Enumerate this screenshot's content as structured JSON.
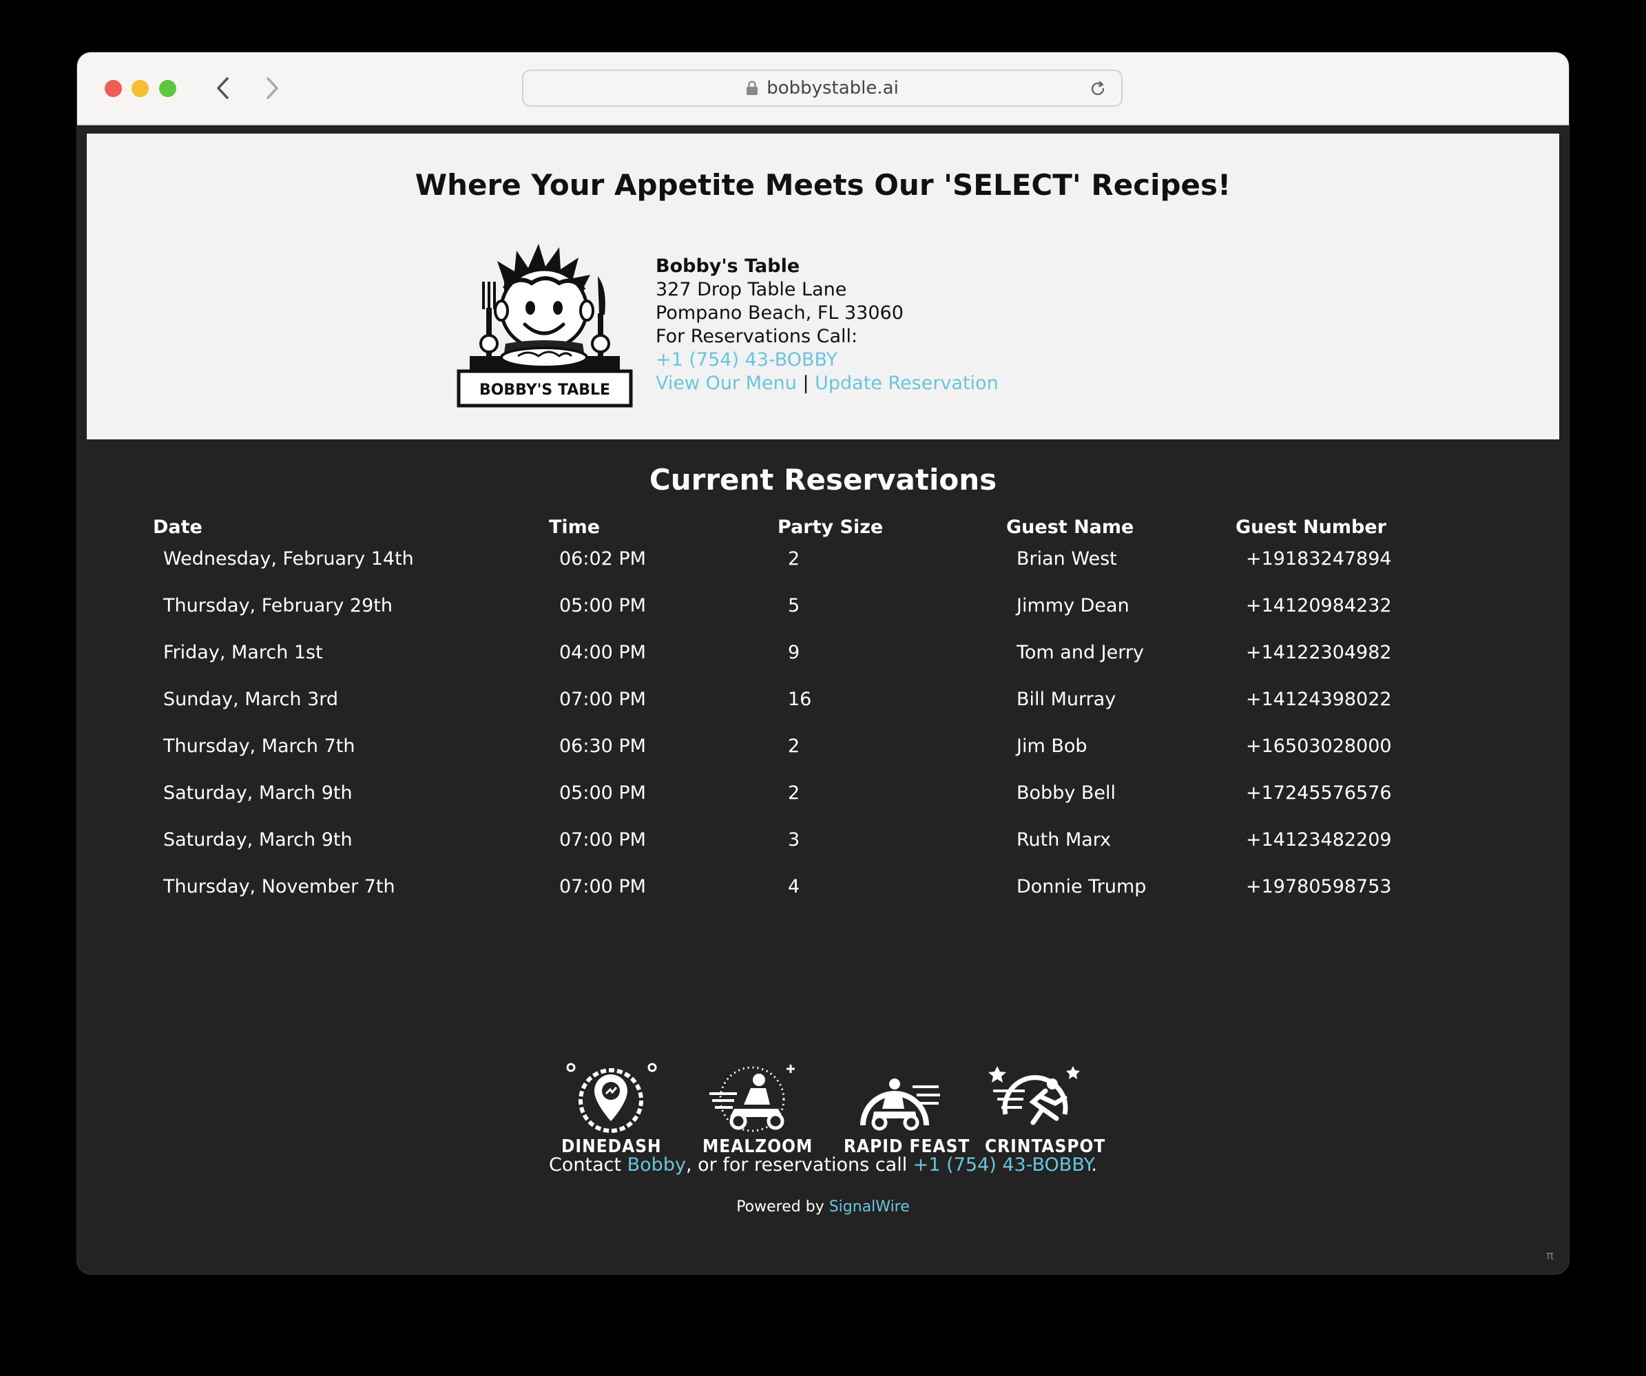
{
  "browser": {
    "url": "bobbystable.ai"
  },
  "header": {
    "headline": "Where Your Appetite Meets Our 'SELECT' Recipes!",
    "logo_text": "BOBBY'S TABLE",
    "restaurant_name": "Bobby's Table",
    "address_line1": "327 Drop Table Lane",
    "address_line2": "Pompano Beach, FL 33060",
    "reservations_label": "For Reservations Call:",
    "phone": "+1 (754) 43-BOBBY",
    "menu_link": "View Our Menu",
    "separator": "|",
    "update_link": "Update Reservation"
  },
  "reservations": {
    "title": "Current Reservations",
    "columns": [
      "Date",
      "Time",
      "Party Size",
      "Guest Name",
      "Guest Number"
    ],
    "rows": [
      [
        "Wednesday, February 14th",
        "06:02 PM",
        "2",
        "Brian West",
        "+19183247894"
      ],
      [
        "Thursday, February 29th",
        "05:00 PM",
        "5",
        "Jimmy Dean",
        "+14120984232"
      ],
      [
        "Friday, March 1st",
        "04:00 PM",
        "9",
        "Tom and Jerry",
        "+14122304982"
      ],
      [
        "Sunday, March 3rd",
        "07:00 PM",
        "16",
        "Bill Murray",
        "+14124398022"
      ],
      [
        "Thursday, March 7th",
        "06:30 PM",
        "2",
        "Jim Bob",
        "+16503028000"
      ],
      [
        "Saturday, March 9th",
        "05:00 PM",
        "2",
        "Bobby Bell",
        "+17245576576"
      ],
      [
        "Saturday, March 9th",
        "07:00 PM",
        "3",
        "Ruth Marx",
        "+14123482209"
      ],
      [
        "Thursday, November 7th",
        "07:00 PM",
        "4",
        "Donnie Trump",
        "+19780598753"
      ]
    ]
  },
  "partners": [
    {
      "name": "DINEDASH",
      "icon": "location-pin-icon"
    },
    {
      "name": "MEALZOOM",
      "icon": "scooter-rider-icon"
    },
    {
      "name": "RAPID FEAST",
      "icon": "delivery-rider-icon"
    },
    {
      "name": "CRINTASPOT",
      "icon": "runner-icon"
    }
  ],
  "footer": {
    "contact_prefix": "Contact ",
    "contact_name": "Bobby",
    "contact_middle": ", or for reservations call ",
    "contact_phone": "+1 (754) 43-BOBBY",
    "contact_suffix": ".",
    "powered_prefix": "Powered by ",
    "powered_link": "SignalWire",
    "corner_mark": "π"
  },
  "colors": {
    "link": "#69c5dd",
    "dark_bg": "#232323",
    "header_bg": "#f2f2f2"
  }
}
